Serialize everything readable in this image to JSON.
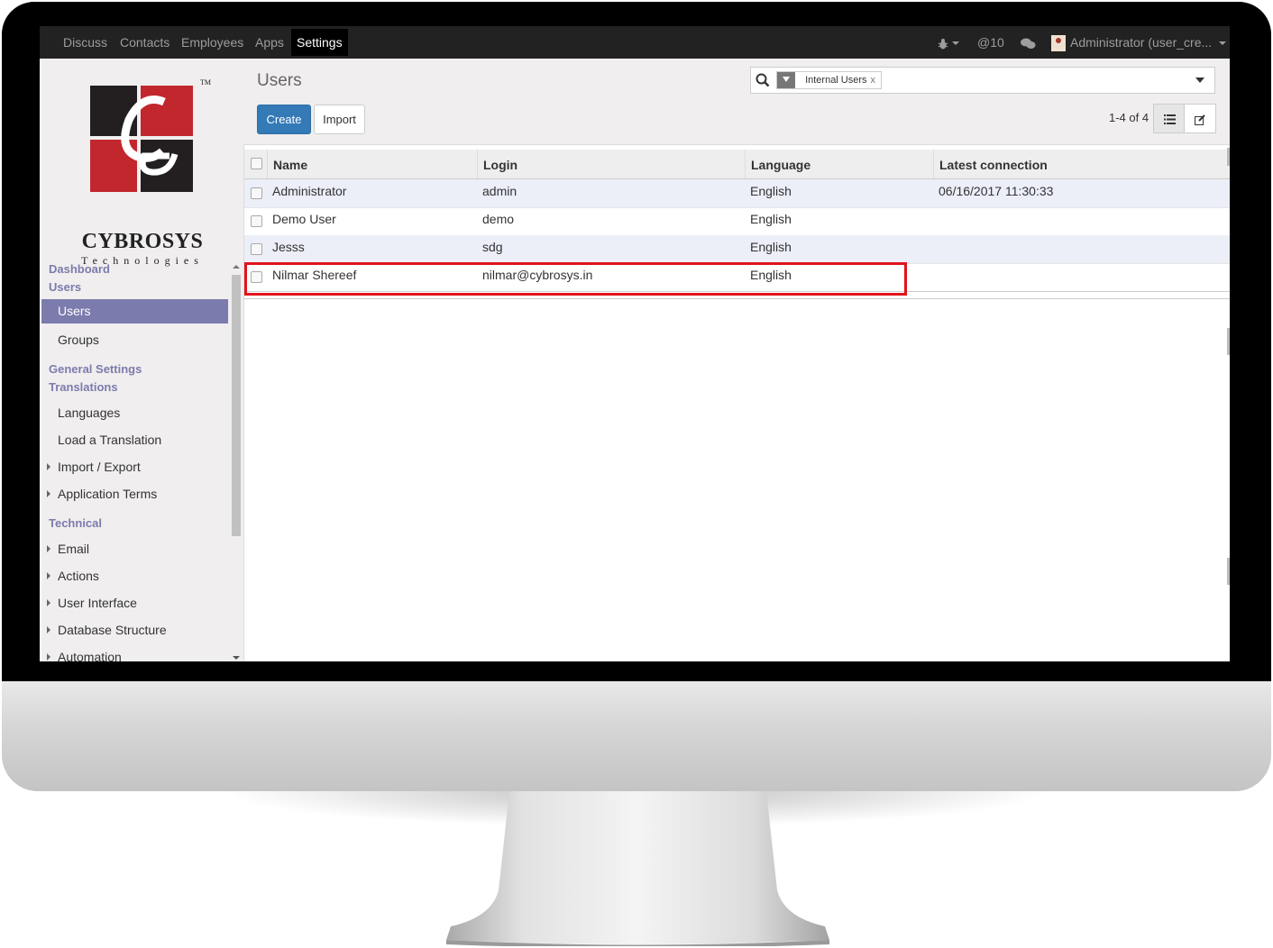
{
  "topbar": {
    "nav": [
      "Discuss",
      "Contacts",
      "Employees",
      "Apps",
      "Settings"
    ],
    "active": "Settings",
    "mentions": "@10",
    "user": "Administrator (user_cre..."
  },
  "sidebar": {
    "brand": "CYBROSYS",
    "brand_sub": "Technologies",
    "brand_tm": "TM",
    "sections": {
      "dashboard": "Dashboard",
      "users": "Users",
      "general": "General Settings",
      "translations": "Translations",
      "technical": "Technical"
    },
    "items": {
      "users": "Users",
      "groups": "Groups",
      "languages": "Languages",
      "load_translation": "Load a Translation",
      "import_export": "Import / Export",
      "app_terms": "Application Terms",
      "email": "Email",
      "actions": "Actions",
      "ui": "User Interface",
      "db": "Database Structure",
      "automation": "Automation"
    }
  },
  "control": {
    "title": "Users",
    "create": "Create",
    "import": "Import",
    "facet": "Internal Users",
    "facet_remove": "x",
    "pager": "1-4 of 4"
  },
  "table": {
    "headers": [
      "Name",
      "Login",
      "Language",
      "Latest connection"
    ],
    "rows": [
      {
        "name": "Administrator",
        "login": "admin",
        "language": "English",
        "last": "06/16/2017 11:30:33"
      },
      {
        "name": "Demo User",
        "login": "demo",
        "language": "English",
        "last": ""
      },
      {
        "name": "Jesss",
        "login": "sdg",
        "language": "English",
        "last": ""
      },
      {
        "name": "Nilmar Shereef",
        "login": "nilmar@cybrosys.in",
        "language": "English",
        "last": ""
      }
    ]
  },
  "colors": {
    "accent": "#7c7bad",
    "primary": "#337ab7",
    "highlight": "#e1141c"
  }
}
